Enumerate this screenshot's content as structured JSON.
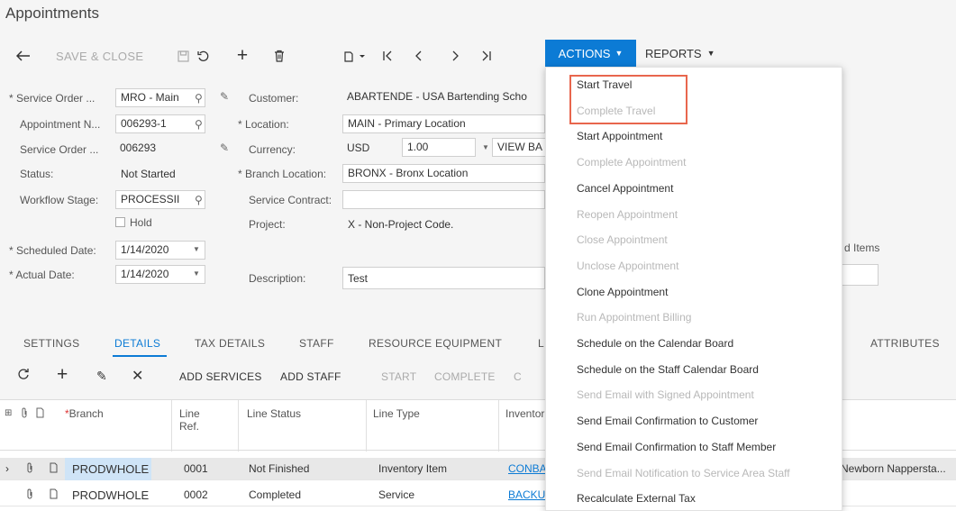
{
  "page": {
    "title": "Appointments"
  },
  "toolbar": {
    "back_icon": "arrow-left-icon",
    "save_close": "SAVE & CLOSE",
    "actions": "ACTIONS",
    "reports": "REPORTS"
  },
  "form": {
    "service_order_type": {
      "label": "Service Order ...",
      "value": "MRO - Main"
    },
    "appointment_nbr": {
      "label": "Appointment N...",
      "value": "006293-1"
    },
    "service_order_nbr": {
      "label": "Service Order ...",
      "value": "006293"
    },
    "status": {
      "label": "Status:",
      "value": "Not Started"
    },
    "workflow_stage": {
      "label": "Workflow Stage:",
      "value": "PROCESSII"
    },
    "hold": {
      "label": "Hold",
      "checked": false
    },
    "scheduled_date": {
      "label": "Scheduled Date:",
      "value": "1/14/2020"
    },
    "actual_date": {
      "label": "Actual Date:",
      "value": "1/14/2020"
    },
    "customer": {
      "label": "Customer:",
      "value": "ABARTENDE - USA Bartending Scho"
    },
    "location": {
      "label": "Location:",
      "value": "MAIN - Primary Location"
    },
    "currency": {
      "label": "Currency:",
      "value": "USD",
      "rate": "1.00",
      "view_base": "VIEW BA"
    },
    "branch_location": {
      "label": "Branch Location:",
      "value": "BRONX - Bronx Location"
    },
    "service_contract": {
      "label": "Service Contract:",
      "value": ""
    },
    "project": {
      "label": "Project:",
      "value": "X - Non-Project Code."
    },
    "description": {
      "label": "Description:",
      "value": "Test"
    },
    "right_partial_label": "d Items"
  },
  "tabs": [
    "SETTINGS",
    "DETAILS",
    "TAX DETAILS",
    "STAFF",
    "RESOURCE EQUIPMENT",
    "L",
    "ATTRIBUTES"
  ],
  "grid_toolbar": {
    "add_services": "ADD SERVICES",
    "add_staff": "ADD STAFF",
    "start": "START",
    "complete": "COMPLETE",
    "partial": "C"
  },
  "grid": {
    "headers": {
      "branch": "Branch",
      "line_ref": "Line\nRef.",
      "line_status": "Line Status",
      "line_type": "Line Type",
      "inventory": "Inventor"
    },
    "rows": [
      {
        "branch": "PRODWHOLE",
        "line_ref": "0001",
        "line_status": "Not Finished",
        "line_type": "Inventory Item",
        "inventory": "CONBA",
        "extra": "Newborn Nappersta..."
      },
      {
        "branch": "PRODWHOLE",
        "line_ref": "0002",
        "line_status": "Completed",
        "line_type": "Service",
        "inventory": "BACKU",
        "extra": ""
      }
    ]
  },
  "actions_menu": {
    "items": [
      {
        "label": "Start Travel",
        "enabled": true
      },
      {
        "label": "Complete Travel",
        "enabled": false
      },
      {
        "label": "Start Appointment",
        "enabled": true
      },
      {
        "label": "Complete Appointment",
        "enabled": false
      },
      {
        "label": "Cancel Appointment",
        "enabled": true
      },
      {
        "label": "Reopen Appointment",
        "enabled": false
      },
      {
        "label": "Close Appointment",
        "enabled": false
      },
      {
        "label": "Unclose Appointment",
        "enabled": false
      },
      {
        "label": "Clone Appointment",
        "enabled": true
      },
      {
        "label": "Run Appointment Billing",
        "enabled": false
      },
      {
        "label": "Schedule on the Calendar Board",
        "enabled": true
      },
      {
        "label": "Schedule on the Staff Calendar Board",
        "enabled": true
      },
      {
        "label": "Send Email with Signed Appointment",
        "enabled": false
      },
      {
        "label": "Send Email Confirmation to Customer",
        "enabled": true
      },
      {
        "label": "Send Email Confirmation to Staff Member",
        "enabled": true
      },
      {
        "label": "Send Email Notification to Service Area Staff",
        "enabled": false
      },
      {
        "label": "Recalculate External Tax",
        "enabled": true
      }
    ],
    "highlight_color": "#e8664d"
  },
  "colors": {
    "accent": "#0c7bd5",
    "link": "#0c7bd5",
    "selected_cell": "#cfe4f7"
  }
}
